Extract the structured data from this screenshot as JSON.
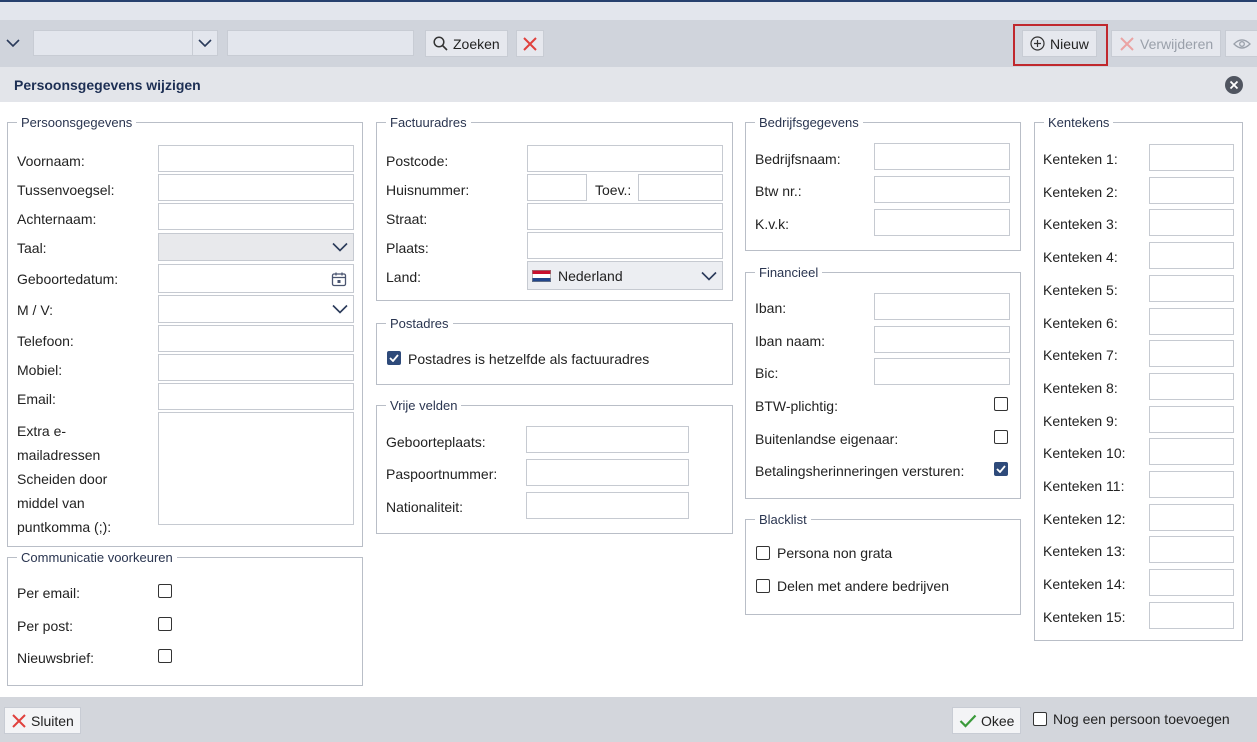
{
  "toolbar": {
    "search_label": "Zoeken",
    "new_label": "Nieuw",
    "delete_label": "Verwijderen"
  },
  "dialog": {
    "title": "Persoonsgegevens wijzigen"
  },
  "persoonsgegevens": {
    "legend": "Persoonsgegevens",
    "voornaam": "Voornaam:",
    "tussenvoegsel": "Tussenvoegsel:",
    "achternaam": "Achternaam:",
    "taal": "Taal:",
    "geboortedatum": "Geboortedatum:",
    "geslacht": "M / V:",
    "telefoon": "Telefoon:",
    "mobiel": "Mobiel:",
    "email": "Email:",
    "extra_email_lines": [
      "Extra e-",
      "mailadressen",
      "Scheiden door",
      "middel van",
      "puntkomma (;):"
    ]
  },
  "communicatie": {
    "legend": "Communicatie voorkeuren",
    "per_email": "Per email:",
    "per_post": "Per post:",
    "nieuwsbrief": "Nieuwsbrief:"
  },
  "factuuradres": {
    "legend": "Factuuradres",
    "postcode": "Postcode:",
    "huisnummer": "Huisnummer:",
    "toev": "Toev.:",
    "straat": "Straat:",
    "plaats": "Plaats:",
    "land": "Land:",
    "land_value": "Nederland"
  },
  "postadres": {
    "legend": "Postadres",
    "same_as_invoice": "Postadres is hetzelfde als factuuradres",
    "same_checked": true
  },
  "vrije_velden": {
    "legend": "Vrije velden",
    "geboorteplaats": "Geboorteplaats:",
    "paspoortnummer": "Paspoortnummer:",
    "nationaliteit": "Nationaliteit:"
  },
  "bedrijfsgegevens": {
    "legend": "Bedrijfsgegevens",
    "bedrijfsnaam": "Bedrijfsnaam:",
    "btw_nr": "Btw nr.:",
    "kvk": "K.v.k:"
  },
  "financieel": {
    "legend": "Financieel",
    "iban": "Iban:",
    "iban_naam": "Iban naam:",
    "bic": "Bic:",
    "btw_plichtig": "BTW-plichtig:",
    "buitenlandse_eigenaar": "Buitenlandse eigenaar:",
    "betalingsherinneringen": "Betalingsherinneringen versturen:"
  },
  "blacklist": {
    "legend": "Blacklist",
    "persona_non_grata": "Persona non grata",
    "delen": "Delen met andere bedrijven"
  },
  "kentekens": {
    "legend": "Kentekens",
    "labels": [
      "Kenteken 1:",
      "Kenteken 2:",
      "Kenteken 3:",
      "Kenteken 4:",
      "Kenteken 5:",
      "Kenteken 6:",
      "Kenteken 7:",
      "Kenteken 8:",
      "Kenteken 9:",
      "Kenteken 10:",
      "Kenteken 11:",
      "Kenteken 12:",
      "Kenteken 13:",
      "Kenteken 14:",
      "Kenteken 15:"
    ]
  },
  "footer": {
    "close_label": "Sluiten",
    "ok_label": "Okee",
    "add_another": "Nog een persoon toevoegen"
  },
  "colors": {
    "accent": "#2e4a7a",
    "highlight": "#c0282d",
    "danger": "#e0413d",
    "ok": "#3a9a3a"
  }
}
